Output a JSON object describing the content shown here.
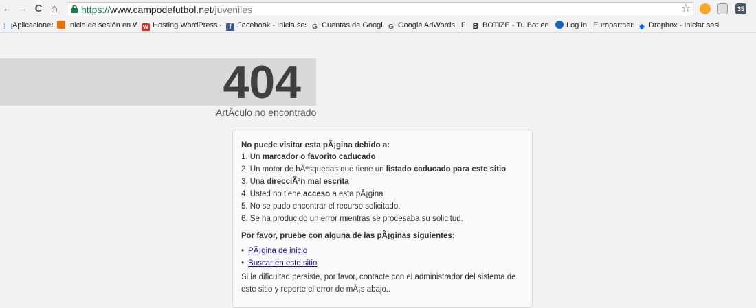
{
  "browser": {
    "url_scheme": "https://",
    "url_host": "www.campodefutbol.net",
    "url_path": "/juveniles",
    "back_icon": "←",
    "forward_icon": "→",
    "reload_icon": "C",
    "home_icon": "⌂",
    "star_icon": "☆",
    "extension_badge": "35"
  },
  "bookmarks": [
    {
      "label": "Aplicaciones",
      "icon": "apps-icon",
      "color": "#4285f4"
    },
    {
      "label": "Inicio de sesión en W",
      "icon": "link-icon",
      "color": "#e8710a"
    },
    {
      "label": "Hosting WordPress - ",
      "icon": "w-icon",
      "color": "#d93025"
    },
    {
      "label": "Facebook - Inicia sesi",
      "icon": "facebook-icon",
      "color": "#3b5998"
    },
    {
      "label": "Cuentas de Google",
      "icon": "google-icon",
      "color": "#555"
    },
    {
      "label": "Google AdWords | Pu",
      "icon": "google-icon",
      "color": "#555"
    },
    {
      "label": "BOTIZE - Tu Bot en Tw",
      "icon": "b-icon",
      "color": "#222"
    },
    {
      "label": "Log in | Europartners",
      "icon": "globe-icon",
      "color": "#1565c0"
    },
    {
      "label": "Dropbox - Iniciar sesi",
      "icon": "dropbox-icon",
      "color": "#0061ff"
    }
  ],
  "error": {
    "code": "404",
    "subtitle": "ArtÃculo no encontrado"
  },
  "box": {
    "heading1": "No puede visitar esta pÃ¡gina debido a:",
    "reasons": [
      {
        "num": "1. Un ",
        "bold": "marcador o favorito caducado",
        "after": ""
      },
      {
        "num": "2. Un motor de bÃºsquedas que tiene un ",
        "bold": "listado caducado para este sitio",
        "after": ""
      },
      {
        "num": "3. Una ",
        "bold": "direcciÃ³n mal escrita",
        "after": ""
      },
      {
        "num": "4. Usted no tiene ",
        "bold": "acceso",
        "after": " a esta pÃ¡gina"
      },
      {
        "num": "5. No se pudo encontrar el recurso solicitado.",
        "bold": "",
        "after": ""
      },
      {
        "num": "6. Se ha producido un error mientras se procesaba su solicitud.",
        "bold": "",
        "after": ""
      }
    ],
    "heading2": "Por favor, pruebe con alguna de las pÃ¡ginas siguientes:",
    "links": [
      "PÃ¡gina de inicio",
      "Buscar en este sitio"
    ],
    "footer": "Si la dificultad persiste, por favor, contacte con el administrador del sistema de este sitio y reporte el error de mÃ¡s abajo.."
  }
}
